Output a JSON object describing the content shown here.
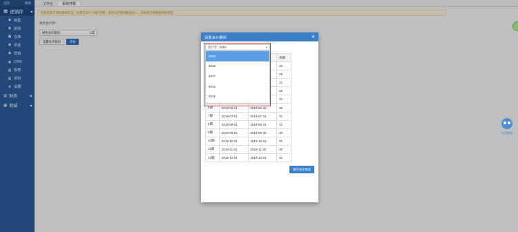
{
  "sidebar": {
    "top_left": "主页",
    "top_right": "帮助",
    "active_module": "进销存",
    "items": [
      {
        "icon": "sales-icon",
        "glyph": "◉",
        "label": "销售"
      },
      {
        "icon": "purchase-icon",
        "glyph": "◉",
        "label": "采购"
      },
      {
        "icon": "warehouse-icon",
        "glyph": "▣",
        "label": "仓库"
      },
      {
        "icon": "funds-icon",
        "glyph": "◉",
        "label": "资金"
      },
      {
        "icon": "marketing-icon",
        "glyph": "◉",
        "label": "营销"
      },
      {
        "icon": "crm-icon",
        "glyph": "◉",
        "label": "CRM"
      },
      {
        "icon": "report-icon",
        "glyph": "▤",
        "label": "报表"
      },
      {
        "icon": "data-icon",
        "glyph": "▤",
        "label": "资料"
      },
      {
        "icon": "settings-icon",
        "glyph": "⚙",
        "label": "设置"
      }
    ],
    "groups": [
      {
        "icon": "finance-icon",
        "glyph": "▥",
        "label": "财务"
      },
      {
        "icon": "mall-icon",
        "glyph": "▦",
        "label": "商城"
      }
    ]
  },
  "tabs": [
    {
      "label": "工作台",
      "active": false
    },
    {
      "label": "系统开账",
      "active": true
    }
  ],
  "notice": "您目前处于期初建帐阶段，设置完会计“开帐”后期，您的仓库期初数据录入，开帐后仓库数据将被锁定",
  "panel": {
    "title": "财务会计年*",
    "field_label": "财务会计期间",
    "field_value": "1年",
    "btn_setup": "设置会计期间",
    "btn_open": "开帐"
  },
  "modal": {
    "title": "设置会计期间",
    "close": "×",
    "year_label": "会计年",
    "year_value": "2019",
    "caret": "▾",
    "dropdown_options": [
      {
        "label": "2019",
        "selected": true
      },
      {
        "label": "2018",
        "selected": false
      },
      {
        "label": "2017",
        "selected": false
      },
      {
        "label": "2016",
        "selected": false
      },
      {
        "label": "2015",
        "selected": false
      }
    ],
    "table_header_days": "天数",
    "rows": [
      {
        "period": "",
        "start": "",
        "end": "",
        "days": "31"
      },
      {
        "period": "",
        "start": "",
        "end": "",
        "days": "28"
      },
      {
        "period": "",
        "start": "",
        "end": "",
        "days": "31"
      },
      {
        "period": "",
        "start": "",
        "end": "",
        "days": "30"
      },
      {
        "period": "",
        "start": "",
        "end": "",
        "days": "31"
      },
      {
        "period": "6期",
        "start": "2019-06-01",
        "end": "2019-06-30",
        "days": "30"
      },
      {
        "period": "7期",
        "start": "2019-07-01",
        "end": "2019-07-31",
        "days": "31"
      },
      {
        "period": "8期",
        "start": "2019-08-01",
        "end": "2019-08-31",
        "days": "31"
      },
      {
        "period": "9期",
        "start": "2019-09-01",
        "end": "2019-09-30",
        "days": "30"
      },
      {
        "period": "10期",
        "start": "2019-10-01",
        "end": "2019-10-31",
        "days": "31"
      },
      {
        "period": "11期",
        "start": "2019-11-01",
        "end": "2019-11-30",
        "days": "30"
      },
      {
        "period": "12期",
        "start": "2019-12-01",
        "end": "2019-12-31",
        "days": "31"
      }
    ],
    "save_label": "保存会计期间"
  },
  "robot_label": "在线客服",
  "colors": {
    "sidebar": "#2b5d9b",
    "modal_header": "#3c7fc9",
    "selected_option": "#5b9ee8",
    "highlight_box": "#d9333f"
  }
}
